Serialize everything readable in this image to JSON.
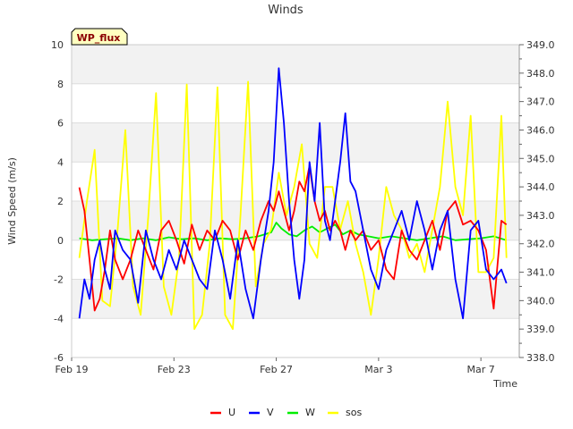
{
  "chart_data": {
    "type": "line",
    "title": "Winds",
    "badge": "WP_flux",
    "xlabel": "Time",
    "ylabel": "Wind Speed (m/s)",
    "x_tick_labels": [
      "Feb 19",
      "Feb 23",
      "Feb 27",
      "Mar 3",
      "Mar 7"
    ],
    "x_ticks_day": [
      0,
      4,
      8,
      12,
      16
    ],
    "x_range_days": [
      0,
      17.5
    ],
    "ylim": [
      -6,
      10
    ],
    "y_ticks": [
      "-6",
      "-4",
      "-2",
      "0",
      "2",
      "4",
      "6",
      "8",
      "10"
    ],
    "ylim_right": [
      338.0,
      349.0
    ],
    "y_ticks_right": [
      "338.0",
      "339.0",
      "340.0",
      "341.0",
      "342.0",
      "343.0",
      "344.0",
      "345.0",
      "346.0",
      "347.0",
      "348.0",
      "349.0"
    ],
    "grid": "horizontal bands",
    "legend_position": "bottom-center",
    "series": [
      {
        "name": "U",
        "color": "#ff0000",
        "axis": "left",
        "x": [
          0.3,
          0.5,
          0.7,
          0.9,
          1.1,
          1.3,
          1.5,
          1.7,
          2.0,
          2.3,
          2.6,
          2.9,
          3.2,
          3.5,
          3.8,
          4.1,
          4.4,
          4.7,
          5.0,
          5.3,
          5.6,
          5.9,
          6.2,
          6.5,
          6.8,
          7.1,
          7.4,
          7.7,
          7.9,
          8.1,
          8.3,
          8.5,
          8.7,
          8.9,
          9.1,
          9.3,
          9.5,
          9.7,
          9.9,
          10.1,
          10.3,
          10.5,
          10.7,
          10.9,
          11.1,
          11.4,
          11.7,
          12.0,
          12.3,
          12.6,
          12.9,
          13.2,
          13.5,
          13.8,
          14.1,
          14.4,
          14.7,
          15.0,
          15.3,
          15.6,
          15.9,
          16.2,
          16.5,
          16.8,
          17.0
        ],
        "y": [
          2.7,
          1.5,
          -1.0,
          -3.6,
          -3.0,
          -1.5,
          0.5,
          -1.0,
          -2.0,
          -1.0,
          0.5,
          -0.5,
          -1.5,
          0.5,
          1.0,
          0.0,
          -1.2,
          0.8,
          -0.5,
          0.5,
          0.0,
          1.0,
          0.5,
          -1.0,
          0.5,
          -0.5,
          1.0,
          2.0,
          1.5,
          2.5,
          1.5,
          0.5,
          1.5,
          3.0,
          2.5,
          3.8,
          2.0,
          1.0,
          1.5,
          0.5,
          1.0,
          0.5,
          -0.5,
          0.5,
          0.0,
          0.5,
          -0.5,
          0.0,
          -1.5,
          -2.0,
          0.5,
          -0.5,
          -1.0,
          0.0,
          1.0,
          -0.5,
          1.5,
          2.0,
          0.8,
          1.0,
          0.5,
          -0.5,
          -3.5,
          1.0,
          0.8
        ]
      },
      {
        "name": "V",
        "color": "#0000ff",
        "axis": "left",
        "x": [
          0.3,
          0.5,
          0.7,
          0.9,
          1.1,
          1.3,
          1.5,
          1.7,
          2.0,
          2.3,
          2.6,
          2.9,
          3.2,
          3.5,
          3.8,
          4.1,
          4.4,
          4.7,
          5.0,
          5.3,
          5.6,
          5.9,
          6.2,
          6.5,
          6.8,
          7.1,
          7.4,
          7.7,
          7.9,
          8.1,
          8.3,
          8.5,
          8.7,
          8.9,
          9.1,
          9.3,
          9.5,
          9.7,
          9.9,
          10.1,
          10.3,
          10.5,
          10.7,
          10.9,
          11.1,
          11.4,
          11.7,
          12.0,
          12.3,
          12.6,
          12.9,
          13.2,
          13.5,
          13.8,
          14.1,
          14.4,
          14.7,
          15.0,
          15.3,
          15.6,
          15.9,
          16.2,
          16.5,
          16.8,
          17.0
        ],
        "y": [
          -4.0,
          -2.0,
          -3.0,
          -1.0,
          0.0,
          -1.5,
          -2.5,
          0.5,
          -0.5,
          -1.0,
          -3.2,
          0.5,
          -1.0,
          -2.0,
          -0.5,
          -1.5,
          0.0,
          -1.0,
          -2.0,
          -2.5,
          0.5,
          -1.0,
          -3.0,
          0.0,
          -2.5,
          -4.0,
          -1.0,
          1.5,
          4.0,
          8.8,
          6.0,
          2.0,
          -1.0,
          -3.0,
          -1.0,
          4.0,
          2.0,
          6.0,
          1.0,
          0.0,
          2.0,
          4.0,
          6.5,
          3.0,
          2.5,
          0.5,
          -1.5,
          -2.5,
          -0.5,
          0.5,
          1.5,
          0.0,
          2.0,
          0.5,
          -1.5,
          0.5,
          1.5,
          -2.0,
          -4.0,
          0.5,
          1.0,
          -1.5,
          -2.0,
          -1.5,
          -2.2
        ]
      },
      {
        "name": "W",
        "color": "#00ee00",
        "axis": "left",
        "x": [
          0.3,
          0.8,
          1.3,
          1.8,
          2.3,
          2.8,
          3.3,
          3.8,
          4.3,
          4.8,
          5.3,
          5.8,
          6.3,
          6.8,
          7.3,
          7.8,
          8.0,
          8.2,
          8.5,
          8.8,
          9.1,
          9.4,
          9.7,
          10.0,
          10.3,
          10.6,
          10.9,
          11.2,
          11.6,
          12.0,
          12.5,
          13.0,
          13.5,
          14.0,
          14.5,
          15.0,
          15.5,
          16.0,
          16.5,
          17.0
        ],
        "y": [
          0.1,
          0.0,
          0.05,
          0.1,
          0.0,
          0.1,
          0.0,
          0.15,
          0.05,
          0.1,
          0.0,
          0.1,
          0.05,
          0.1,
          0.2,
          0.4,
          0.9,
          0.6,
          0.3,
          0.2,
          0.5,
          0.7,
          0.4,
          0.6,
          0.8,
          0.3,
          0.5,
          0.3,
          0.2,
          0.1,
          0.2,
          0.1,
          0.0,
          0.1,
          0.2,
          0.0,
          0.05,
          0.1,
          0.2,
          0.0
        ]
      },
      {
        "name": "sos",
        "color": "#ffff00",
        "axis": "right",
        "x": [
          0.3,
          0.6,
          0.9,
          1.2,
          1.5,
          1.8,
          2.1,
          2.4,
          2.7,
          3.0,
          3.3,
          3.6,
          3.9,
          4.2,
          4.5,
          4.8,
          5.1,
          5.4,
          5.7,
          6.0,
          6.3,
          6.6,
          6.9,
          7.2,
          7.5,
          7.8,
          8.1,
          8.4,
          8.7,
          9.0,
          9.3,
          9.6,
          9.9,
          10.2,
          10.5,
          10.8,
          11.1,
          11.4,
          11.7,
          12.0,
          12.3,
          12.6,
          12.9,
          13.2,
          13.5,
          13.8,
          14.1,
          14.4,
          14.7,
          15.0,
          15.3,
          15.6,
          15.9,
          16.2,
          16.5,
          16.8,
          17.0
        ],
        "y": [
          341.5,
          343.5,
          345.3,
          340.0,
          339.8,
          342.5,
          346.0,
          340.5,
          339.5,
          343.0,
          347.3,
          340.5,
          339.5,
          341.5,
          347.6,
          339.0,
          339.5,
          342.0,
          347.5,
          339.5,
          339.0,
          343.0,
          347.7,
          340.5,
          342.0,
          342.5,
          344.5,
          343.0,
          344.0,
          345.5,
          342.0,
          341.5,
          344.0,
          344.0,
          342.5,
          343.5,
          342.0,
          341.0,
          339.5,
          341.5,
          344.0,
          343.0,
          342.5,
          341.5,
          342.0,
          341.0,
          342.5,
          344.0,
          347.0,
          344.0,
          343.0,
          346.5,
          341.0,
          341.0,
          341.5,
          346.5,
          341.5
        ]
      }
    ]
  }
}
